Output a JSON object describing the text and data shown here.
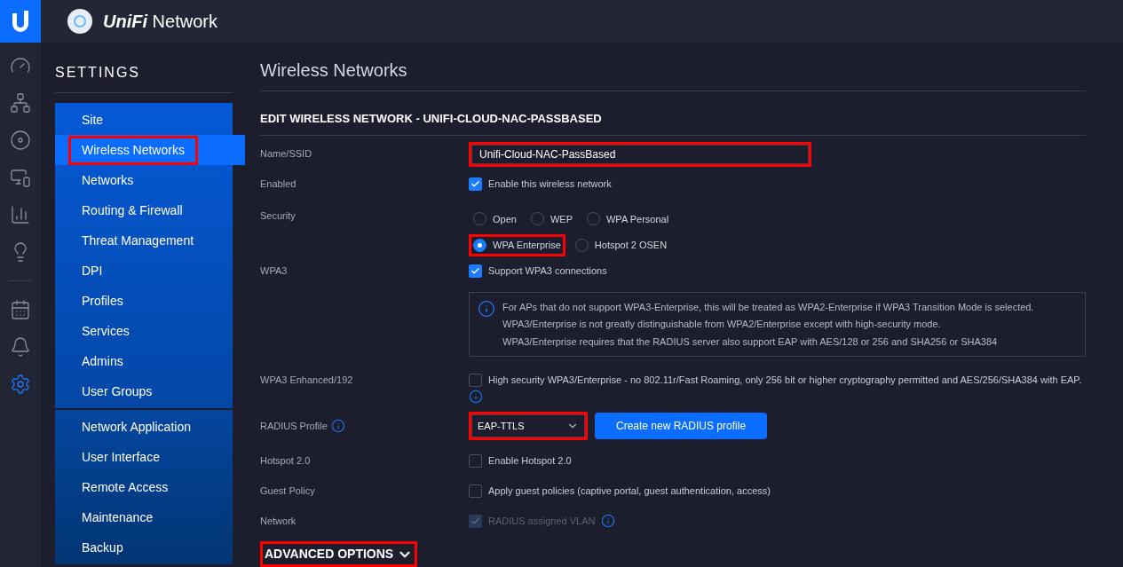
{
  "app": {
    "title_brand": "UniFi",
    "title_product": "Network"
  },
  "rail": [
    {
      "selected": false
    },
    {
      "selected": false
    },
    {
      "selected": false
    },
    {
      "selected": false
    },
    {
      "selected": false
    },
    {
      "selected": false
    },
    {
      "selected": false
    },
    {
      "selected": false
    },
    {
      "selected": true
    }
  ],
  "sidebar": {
    "title": "SETTINGS",
    "groups": [
      [
        {
          "label": "Site",
          "selected": false,
          "highlighted": false
        },
        {
          "label": "Wireless Networks",
          "selected": true,
          "highlighted": true
        },
        {
          "label": "Networks",
          "selected": false,
          "highlighted": false
        },
        {
          "label": "Routing & Firewall",
          "selected": false,
          "highlighted": false
        },
        {
          "label": "Threat Management",
          "selected": false,
          "highlighted": false
        },
        {
          "label": "DPI",
          "selected": false,
          "highlighted": false
        },
        {
          "label": "Profiles",
          "selected": false,
          "highlighted": false
        },
        {
          "label": "Services",
          "selected": false,
          "highlighted": false
        },
        {
          "label": "Admins",
          "selected": false,
          "highlighted": false
        },
        {
          "label": "User Groups",
          "selected": false,
          "highlighted": false
        }
      ],
      [
        {
          "label": "Network Application",
          "selected": false,
          "highlighted": false
        },
        {
          "label": "User Interface",
          "selected": false,
          "highlighted": false
        },
        {
          "label": "Remote Access",
          "selected": false,
          "highlighted": false
        },
        {
          "label": "Maintenance",
          "selected": false,
          "highlighted": false
        },
        {
          "label": "Backup",
          "selected": false,
          "highlighted": false
        }
      ]
    ]
  },
  "page": {
    "title": "Wireless Networks",
    "section": "EDIT WIRELESS NETWORK - UNIFI-CLOUD-NAC-PASSBASED"
  },
  "form": [
    {
      "kind": "text",
      "label": "Name/SSID",
      "value": "Unifi-Cloud-NAC-PassBased",
      "highlighted": true
    },
    {
      "kind": "checkbox",
      "label": "Enabled",
      "text": "Enable this wireless network",
      "checked": true
    },
    {
      "kind": "radio",
      "label": "Security",
      "options": [
        {
          "label": "Open",
          "selected": false,
          "highlighted": false
        },
        {
          "label": "WEP",
          "selected": false,
          "highlighted": false
        },
        {
          "label": "WPA Personal",
          "selected": false,
          "highlighted": false
        },
        {
          "label": "WPA Enterprise",
          "selected": true,
          "highlighted": true
        },
        {
          "label": "Hotspot 2 OSEN",
          "selected": false,
          "highlighted": false
        }
      ]
    },
    {
      "kind": "checkbox",
      "label": "WPA3",
      "text": "Support WPA3 connections",
      "checked": true
    },
    {
      "kind": "info",
      "lines": [
        "For APs that do not support WPA3-Enterprise, this will be treated as WPA2-Enterprise if WPA3 Transition Mode is selected.",
        "WPA3/Enterprise is not greatly distinguishable from WPA2/Enterprise except with high-security mode.",
        "WPA3/Enterprise requires that the RADIUS server also support EAP with AES/128 or 256 and SHA256 or SHA384"
      ]
    },
    {
      "kind": "checkbox",
      "label": "WPA3 Enhanced/192",
      "text": "High security WPA3/Enterprise - no 802.11r/Fast Roaming, only 256 bit or higher cryptography permitted and AES/256/SHA384 with EAP.",
      "checked": false,
      "info_below": true
    },
    {
      "kind": "select",
      "label": "RADIUS Profile",
      "label_info": true,
      "value": "EAP-TTLS",
      "highlighted": true,
      "button": "Create new RADIUS profile"
    },
    {
      "kind": "checkbox",
      "label": "Hotspot 2.0",
      "text": "Enable Hotspot 2.0",
      "checked": false
    },
    {
      "kind": "checkbox",
      "label": "Guest Policy",
      "text": "Apply guest policies (captive portal, guest authentication, access)",
      "checked": false
    },
    {
      "kind": "checkbox",
      "label": "Network",
      "text": "RADIUS assigned VLAN",
      "checked": true,
      "disabled": true,
      "info_after": true
    }
  ],
  "advanced": {
    "label": "ADVANCED OPTIONS",
    "expanded": false,
    "highlighted": true
  }
}
